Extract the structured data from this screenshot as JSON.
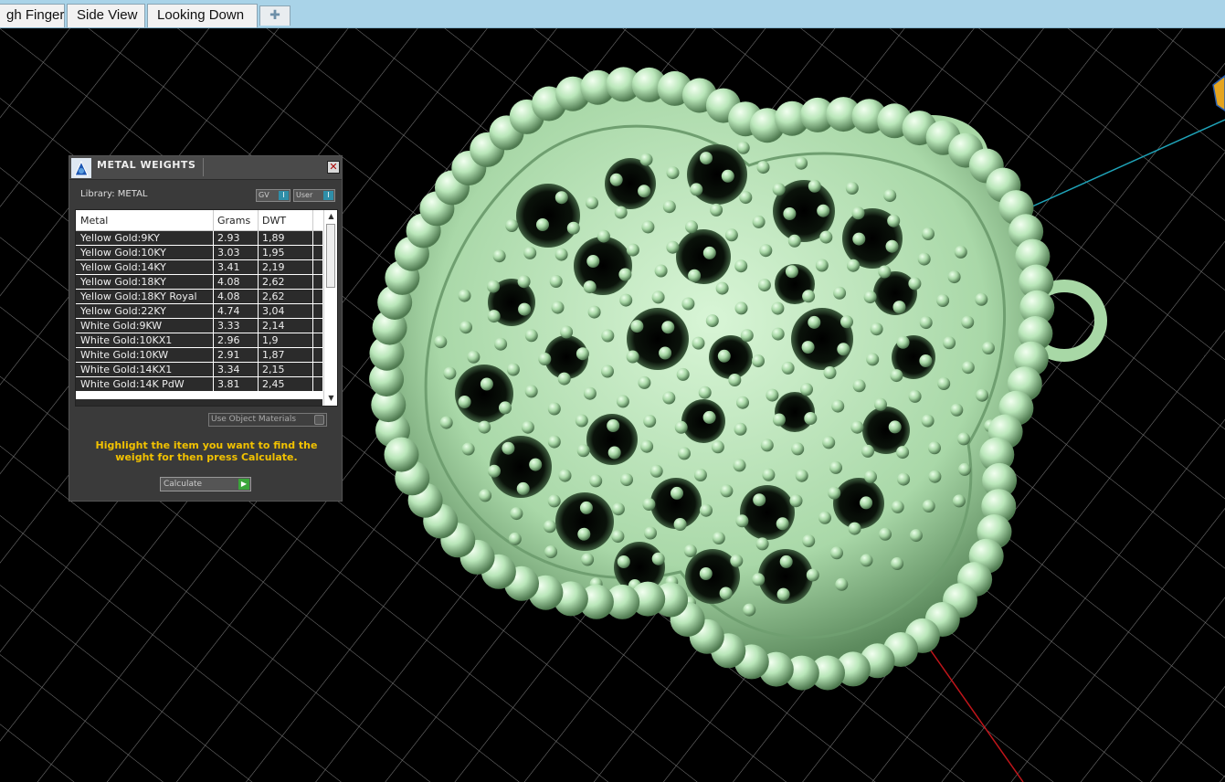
{
  "tabs": [
    {
      "label": "gh Finger"
    },
    {
      "label": "Side View"
    },
    {
      "label": "Looking Down"
    }
  ],
  "add_tab_icon": "plus-icon",
  "model_color": "#b9e6b9",
  "panel": {
    "title": "METAL WEIGHTS",
    "library_label": "Library: METAL",
    "gv_toggle": "GV",
    "user_toggle": "User",
    "toggle_knob": "I",
    "columns": [
      "Metal",
      "Grams",
      "DWT"
    ],
    "rows": [
      {
        "metal": "Yellow Gold:9KY",
        "grams": "2.93",
        "dwt": "1,89"
      },
      {
        "metal": "Yellow Gold:10KY",
        "grams": "3.03",
        "dwt": "1,95"
      },
      {
        "metal": "Yellow Gold:14KY",
        "grams": "3.41",
        "dwt": "2,19"
      },
      {
        "metal": "Yellow Gold:18KY",
        "grams": "4.08",
        "dwt": "2,62"
      },
      {
        "metal": "Yellow Gold:18KY Royal",
        "grams": "4.08",
        "dwt": "2,62"
      },
      {
        "metal": "Yellow Gold:22KY",
        "grams": "4.74",
        "dwt": "3,04"
      },
      {
        "metal": "White Gold:9KW",
        "grams": "3.33",
        "dwt": "2,14"
      },
      {
        "metal": "White Gold:10KX1",
        "grams": "2.96",
        "dwt": "1,9"
      },
      {
        "metal": "White Gold:10KW",
        "grams": "2.91",
        "dwt": "1,87"
      },
      {
        "metal": "White Gold:14KX1",
        "grams": "3.34",
        "dwt": "2,15"
      },
      {
        "metal": "White Gold:14K PdW",
        "grams": "3.81",
        "dwt": "2,45"
      }
    ],
    "use_object_materials": "Use Object Materials",
    "hint": "Highlight the item you want to find the weight for then press Calculate.",
    "calculate_label": "Calculate"
  }
}
